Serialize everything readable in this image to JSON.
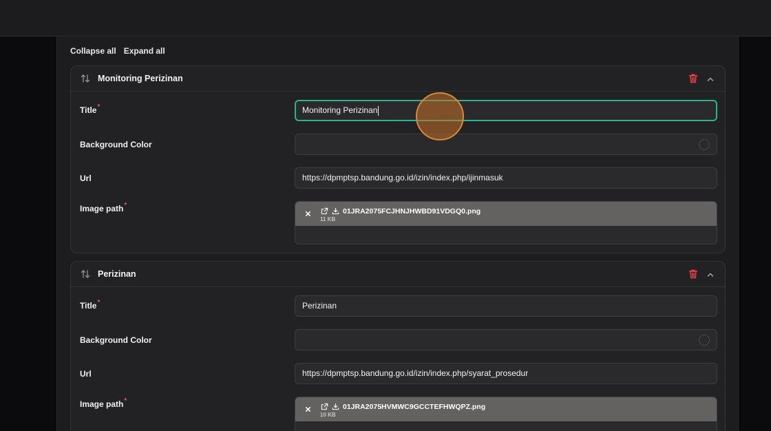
{
  "toolbar": {
    "collapse_all": "Collapse all",
    "expand_all": "Expand all"
  },
  "blocks": [
    {
      "header_title": "Monitoring Perizinan",
      "title_label": "Title",
      "title_value": "Monitoring Perizinan",
      "bg_label": "Background Color",
      "url_label": "Url",
      "url_value": "https://dpmptsp.bandung.go.id/izin/index.php/ijinmasuk",
      "image_label": "Image path",
      "file_name": "01JRA2075FCJHNJHWBD91VDGQ0.png",
      "file_size": "11 KB"
    },
    {
      "header_title": "Perizinan",
      "title_label": "Title",
      "title_value": "Perizinan",
      "bg_label": "Background Color",
      "url_label": "Url",
      "url_value": "https://dpmptsp.bandung.go.id/izin/index.php/syarat_prosedur",
      "image_label": "Image path",
      "file_name": "01JRA2075HVMWC9GCCTEFHWQPZ.png",
      "file_size": "10 KB"
    }
  ],
  "required_marker": "*",
  "colors": {
    "accent_focus": "#2bb58f",
    "danger": "#ef4444",
    "required": "#e25c5c"
  },
  "icons": [
    "sort-icon",
    "trash-icon",
    "chevron-up-icon",
    "close-icon",
    "external-link-icon",
    "download-icon",
    "color-swatch-icon"
  ]
}
